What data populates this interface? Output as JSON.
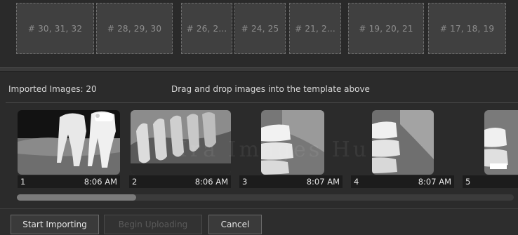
{
  "template": {
    "slots": [
      {
        "label": "# 30, 31, 32"
      },
      {
        "label": "# 28, 29, 30"
      },
      {
        "label": "# 26, 2..."
      },
      {
        "label": "# 24, 25"
      },
      {
        "label": "# 21, 2..."
      },
      {
        "label": "# 19, 20, 21"
      },
      {
        "label": "# 17, 18, 19"
      }
    ]
  },
  "imported": {
    "count_label": "Imported Images: 20",
    "hint": "Drag and drop images into the template above"
  },
  "thumbnails": [
    {
      "number": "1",
      "time": "8:06 AM"
    },
    {
      "number": "2",
      "time": "8:06 AM"
    },
    {
      "number": "3",
      "time": "8:07 AM"
    },
    {
      "number": "4",
      "time": "8:07 AM"
    },
    {
      "number": "5",
      "time": ""
    }
  ],
  "watermark": "Ira Images Hu",
  "scrollbar": {
    "position_fraction": 0.0
  },
  "buttons": {
    "start_importing": "Start Importing",
    "begin_uploading": "Begin Uploading",
    "cancel": "Cancel"
  }
}
